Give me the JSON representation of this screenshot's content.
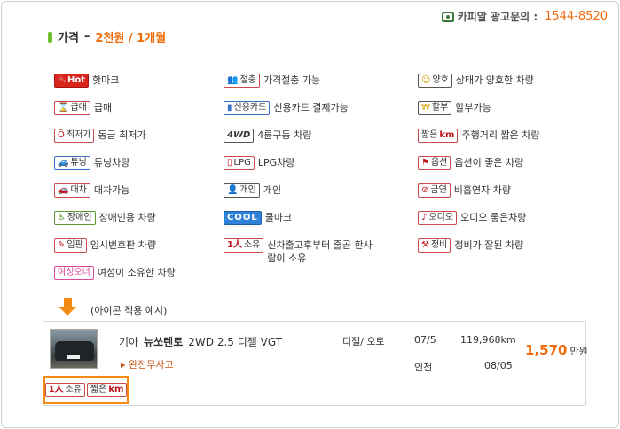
{
  "header": {
    "contact_label": "카피알 광고문의 :",
    "contact_number": "1544-8520",
    "title_prefix": "가격",
    "title_dash": "–",
    "title_highlight": "2천원 / 1개월"
  },
  "icons": [
    {
      "badge": "Hot",
      "label": "핫마크"
    },
    {
      "badge": "절충",
      "label": "가격절충 가능"
    },
    {
      "badge": "양호",
      "label": "상태가 양호한 차량"
    },
    {
      "badge": "급매",
      "label": "급매"
    },
    {
      "badge": "신용카드",
      "label": "신용카드 결제가능"
    },
    {
      "badge": "할부",
      "label": "할부가능"
    },
    {
      "badge": "최저가",
      "label": "동급 최저가"
    },
    {
      "badge": "4WD",
      "label": "4륜구동 차량"
    },
    {
      "badge_a": "짧은",
      "badge_b": "km",
      "label": "주행거리 짧은 차량"
    },
    {
      "badge": "튜닝",
      "label": "튜닝차량"
    },
    {
      "badge": "LPG",
      "label": "LPG차량"
    },
    {
      "badge": "옵션",
      "label": "옵션이 좋은 차량"
    },
    {
      "badge": "대차",
      "label": "대차가능"
    },
    {
      "badge": "개인",
      "label": "개인"
    },
    {
      "badge": "금연",
      "label": "비흡연자 차량"
    },
    {
      "badge": "장애인",
      "label": "장애인용 차량"
    },
    {
      "badge": "COOL",
      "label": "쿨마크"
    },
    {
      "badge": "오디오",
      "label": "오디오 좋은차량"
    },
    {
      "badge": "임판",
      "label": "임시번호판 차량"
    },
    {
      "badge_a": "1人",
      "badge_b": "소유",
      "label": "신차출고후부터 줄곧 한사람이 소유"
    },
    {
      "badge": "정비",
      "label": "정비가 잘된 차량"
    },
    {
      "badge": "여성오너",
      "label": "여성이 소유한 차량"
    }
  ],
  "example": {
    "label": "(아이콘 적용 예시)",
    "brand": "기아",
    "model": "뉴쏘렌토",
    "spec": "2WD 2.5 디젤 VGT",
    "dealer": "▸ 완전무사고",
    "fuel_trans": "디젤/ 오토",
    "year": "07/5",
    "mileage": "119,968km",
    "region": "인천",
    "date": "08/05",
    "price": "1,570",
    "price_unit": "만원",
    "badge1_a": "1人",
    "badge1_b": "소유",
    "badge2_a": "짧은",
    "badge2_b": "km"
  },
  "colors": {
    "accent": "#f26a0a",
    "highlight_border": "#f28a14"
  }
}
